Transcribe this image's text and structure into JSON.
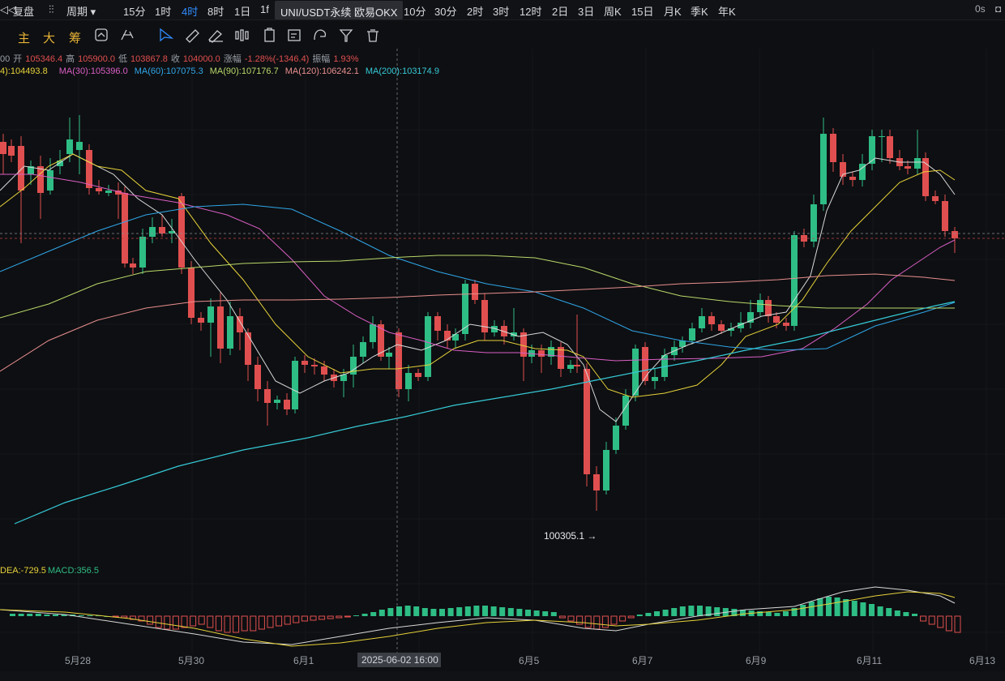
{
  "toolbar": {
    "left_icon": "◁◁",
    "fupan": "复盘",
    "period_label": "周期",
    "intervals": [
      "15分",
      "1时",
      "4时",
      "8时",
      "1日",
      "1f"
    ],
    "active_interval": "4时",
    "popup_title": "UNI/USDT永续 欧易OKX",
    "intervals_right": [
      "10分",
      "30分",
      "2时",
      "3时",
      "12时",
      "2日",
      "3日",
      "周K",
      "15日",
      "月K",
      "季K",
      "年K"
    ],
    "timer": "0s"
  },
  "toolbar2": {
    "labels": [
      "主",
      "大",
      "筹"
    ],
    "icons": [
      "reset-icon",
      "indicator-icon",
      "cursor-icon",
      "ruler-icon",
      "brush-icon",
      "pattern-icon",
      "clipboard-icon",
      "note-icon",
      "magnet-icon",
      "filter-icon",
      "trash-icon"
    ]
  },
  "ohlc": {
    "prefix": "00",
    "open_label": "开",
    "open": "105346.4",
    "high_label": "高",
    "high": "105900.0",
    "low_label": "低",
    "low": "103867.8",
    "close_label": "收",
    "close": "104000.0",
    "change_label": "涨幅",
    "change": "-1.28%(-1346.4)",
    "amp_label": "振幅",
    "amp": "1.93%"
  },
  "ma": [
    {
      "label": "4):104493.8",
      "color": "#e6d23a"
    },
    {
      "label": "MA(30):105396.0",
      "color": "#d95fc5"
    },
    {
      "label": "MA(60):107075.3",
      "color": "#2fa6e8"
    },
    {
      "label": "MA(90):107176.7",
      "color": "#b9d96a"
    },
    {
      "label": "MA(120):106242.1",
      "color": "#e88f8f"
    },
    {
      "label": "MA(200):103174.9",
      "color": "#35c9d6"
    }
  ],
  "low_marker": "100305.1 →",
  "macd": {
    "dea": "DEA:-729.5",
    "macd": "MACD:356.5"
  },
  "dates": [
    "5月28",
    "5月30",
    "6月1",
    "6月5",
    "6月7",
    "6月9",
    "6月11",
    "6月13"
  ],
  "date_cursor": "2025-06-02 16:00",
  "colors": {
    "up": "#2ebd85",
    "down": "#e04f4f",
    "bg": "#0e0f12"
  }
}
